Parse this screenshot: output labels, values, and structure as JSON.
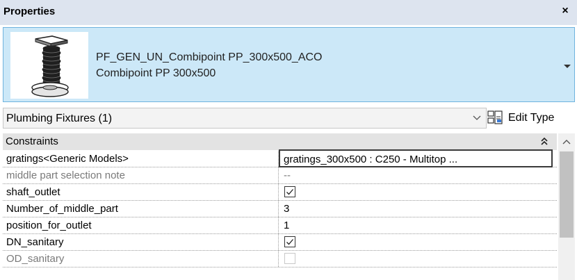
{
  "window": {
    "title": "Properties",
    "close_glyph": "×"
  },
  "type_selector": {
    "family_name": "PF_GEN_UN_Combipoint PP_300x500_ACO",
    "type_name": "Combipoint PP 300x500",
    "thumbnail_icon": "combipoint-fixture-icon",
    "dropdown_icon": "caret-down-icon"
  },
  "category": {
    "label": "Plumbing Fixtures (1)",
    "dropdown_icon": "chevron-down-icon"
  },
  "edit_type": {
    "label": "Edit Type",
    "icon": "edit-type-icon"
  },
  "grid": {
    "group": {
      "label": "Constraints",
      "collapse_icon": "double-chevron-up-icon"
    },
    "rows": [
      {
        "name": "gratings<Generic Models>",
        "kind": "text",
        "value": "gratings_300x500 : C250 - Multitop ...",
        "selected": true,
        "disabled": false
      },
      {
        "name": "middle part selection note",
        "kind": "text",
        "value": "--",
        "selected": false,
        "disabled": true
      },
      {
        "name": "shaft_outlet",
        "kind": "checkbox",
        "checked": true,
        "disabled": false
      },
      {
        "name": "Number_of_middle_part",
        "kind": "text",
        "value": "3",
        "selected": false,
        "disabled": false
      },
      {
        "name": "position_for_outlet",
        "kind": "text",
        "value": "1",
        "selected": false,
        "disabled": false
      },
      {
        "name": "DN_sanitary",
        "kind": "checkbox",
        "checked": true,
        "disabled": false
      },
      {
        "name": "OD_sanitary",
        "kind": "checkbox",
        "checked": false,
        "disabled": true
      }
    ]
  },
  "colors": {
    "title_bar": "#dde4ef",
    "selector_bg": "#cce8f8",
    "selector_border": "#6fb3de",
    "group_header": "#e3e3e3"
  }
}
